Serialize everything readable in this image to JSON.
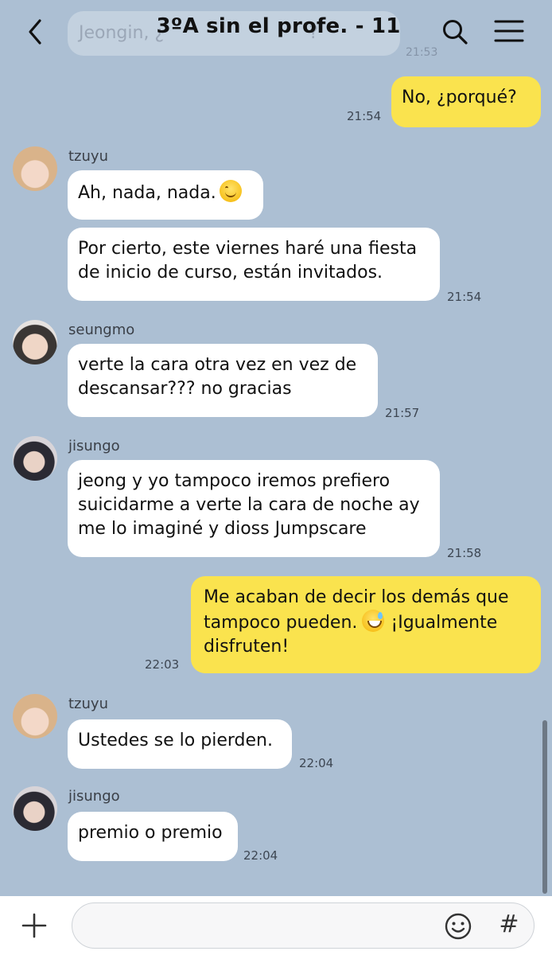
{
  "header": {
    "title": "3ºA sin el profe. - 11",
    "partial_message_text": "Jeongin, ¿",
    "partial_message_suffix": "?",
    "partial_time": "21:53"
  },
  "messages": [
    {
      "type": "me",
      "text": "No, ¿porqué?",
      "time": "21:54"
    },
    {
      "type": "other",
      "sender": "tzuyu",
      "avatar": "tzuyu-avatar",
      "bubbles": [
        {
          "text": "Ah, nada, nada.",
          "emoji": "smiling-face-icon"
        },
        {
          "lines": [
            "Por cierto, este viernes haré una fiesta",
            "de inicio de curso, están invitados."
          ]
        }
      ],
      "time": "21:54"
    },
    {
      "type": "other",
      "sender": "seungmo",
      "avatar": "seungmo-avatar",
      "bubbles": [
        {
          "lines": [
            "verte la cara otra vez en vez de",
            "descansar??? no gracias"
          ]
        }
      ],
      "time": "21:57"
    },
    {
      "type": "other",
      "sender": "jisungo",
      "avatar": "jisungo-avatar",
      "bubbles": [
        {
          "lines": [
            "jeong y yo tampoco iremos prefiero",
            "suicidarme a verte la cara de noche ay",
            "me lo imaginé y dioss Jumpscare"
          ]
        }
      ],
      "time": "21:58"
    },
    {
      "type": "me",
      "lines": [
        "Me acaban de decir los demás que",
        "tampoco pueden.",
        "¡Igualmente",
        "disfruten!"
      ],
      "emoji": "grinning-sweat-icon",
      "time": "22:03"
    },
    {
      "type": "other",
      "sender": "tzuyu",
      "avatar": "tzuyu-avatar",
      "bubbles": [
        {
          "text": "Ustedes se lo pierden."
        }
      ],
      "time": "22:04"
    },
    {
      "type": "other",
      "sender": "jisungo",
      "avatar": "jisungo-avatar",
      "bubbles": [
        {
          "text": "premio o premio"
        }
      ],
      "time": "22:04"
    }
  ],
  "input": {
    "value": "",
    "placeholder": ""
  },
  "colors": {
    "background": "#acbfd3",
    "my_bubble": "#fae34e",
    "other_bubble": "#ffffff"
  }
}
